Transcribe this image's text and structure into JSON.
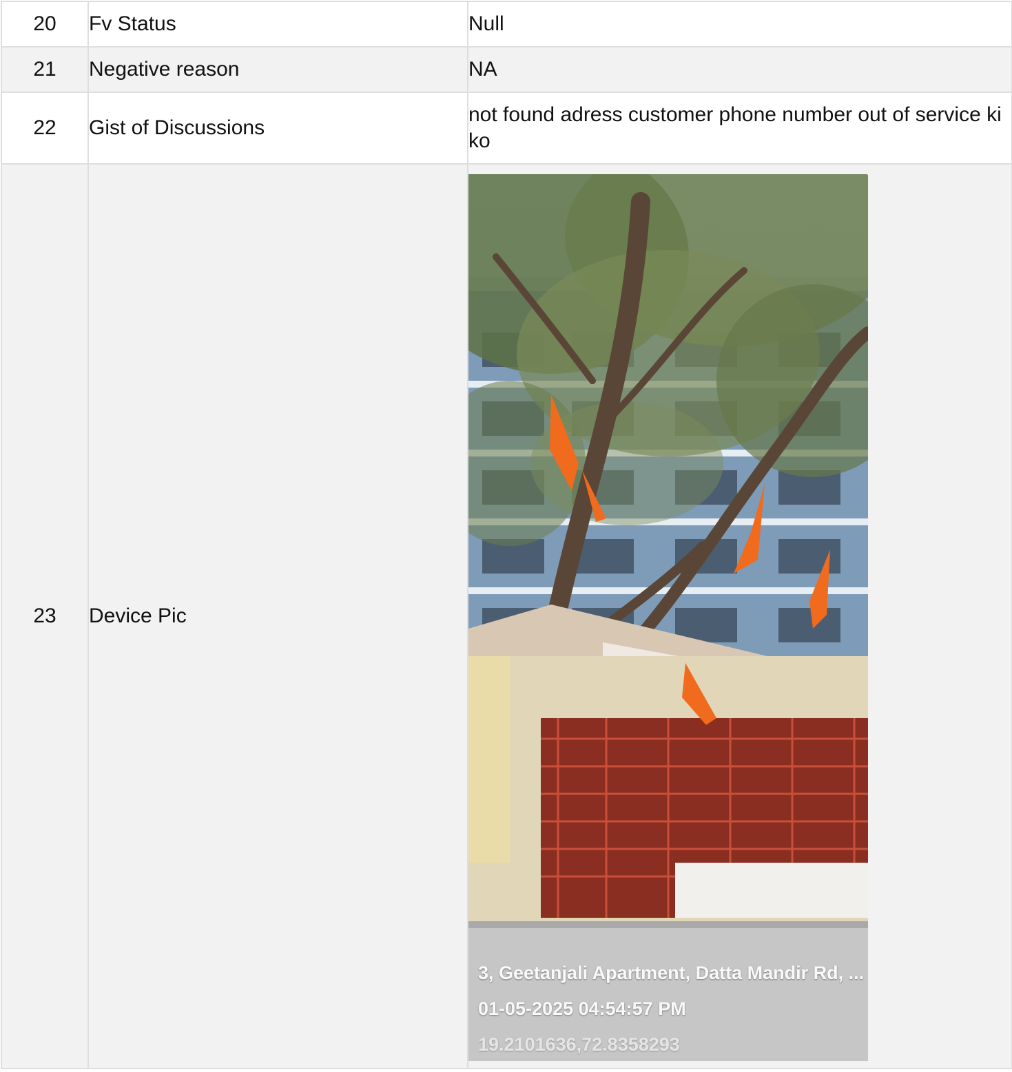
{
  "rows": [
    {
      "no": "20",
      "label": "Fv Status",
      "value": "Null"
    },
    {
      "no": "21",
      "label": "Negative reason",
      "value": "NA"
    },
    {
      "no": "22",
      "label": "Gist of Discussions",
      "value": "not found adress customer phone number out of service ki ko"
    },
    {
      "no": "23",
      "label": "Device Pic"
    }
  ],
  "device_pic": {
    "stamp_address": "3, Geetanjali Apartment, Datta Mandir Rd, ...",
    "stamp_datetime": "01-05-2025 04:54:57 PM",
    "stamp_coords": "19.2101636,72.8358293"
  }
}
